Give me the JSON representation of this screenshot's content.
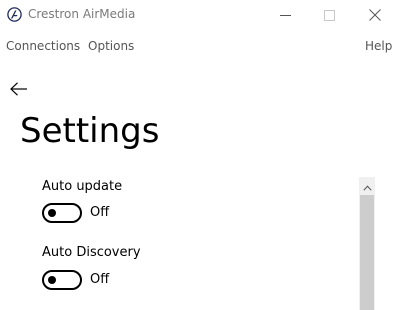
{
  "window": {
    "title": "Crestron AirMedia",
    "logo_icon": "crestron-airmedia-logo",
    "controls": [
      "minimize-icon",
      "maximize-icon",
      "close-icon"
    ]
  },
  "menu": {
    "connections": "Connections",
    "options": "Options",
    "help": "Help"
  },
  "page": {
    "back_icon": "back-arrow-icon",
    "title": "Settings"
  },
  "settings": {
    "auto_update": {
      "label": "Auto update",
      "state": "Off",
      "on": false
    },
    "auto_discovery": {
      "label": "Auto Discovery",
      "state": "Off",
      "on": false
    }
  },
  "scrollbar": {
    "up_icon": "scroll-up-arrow-icon"
  },
  "colors": {
    "title_text": "#7a7a7a",
    "menu_text": "#555555",
    "toggle_stroke": "#000000",
    "scroll_track": "#f0f0f0",
    "scroll_thumb": "#cdcdcd"
  }
}
